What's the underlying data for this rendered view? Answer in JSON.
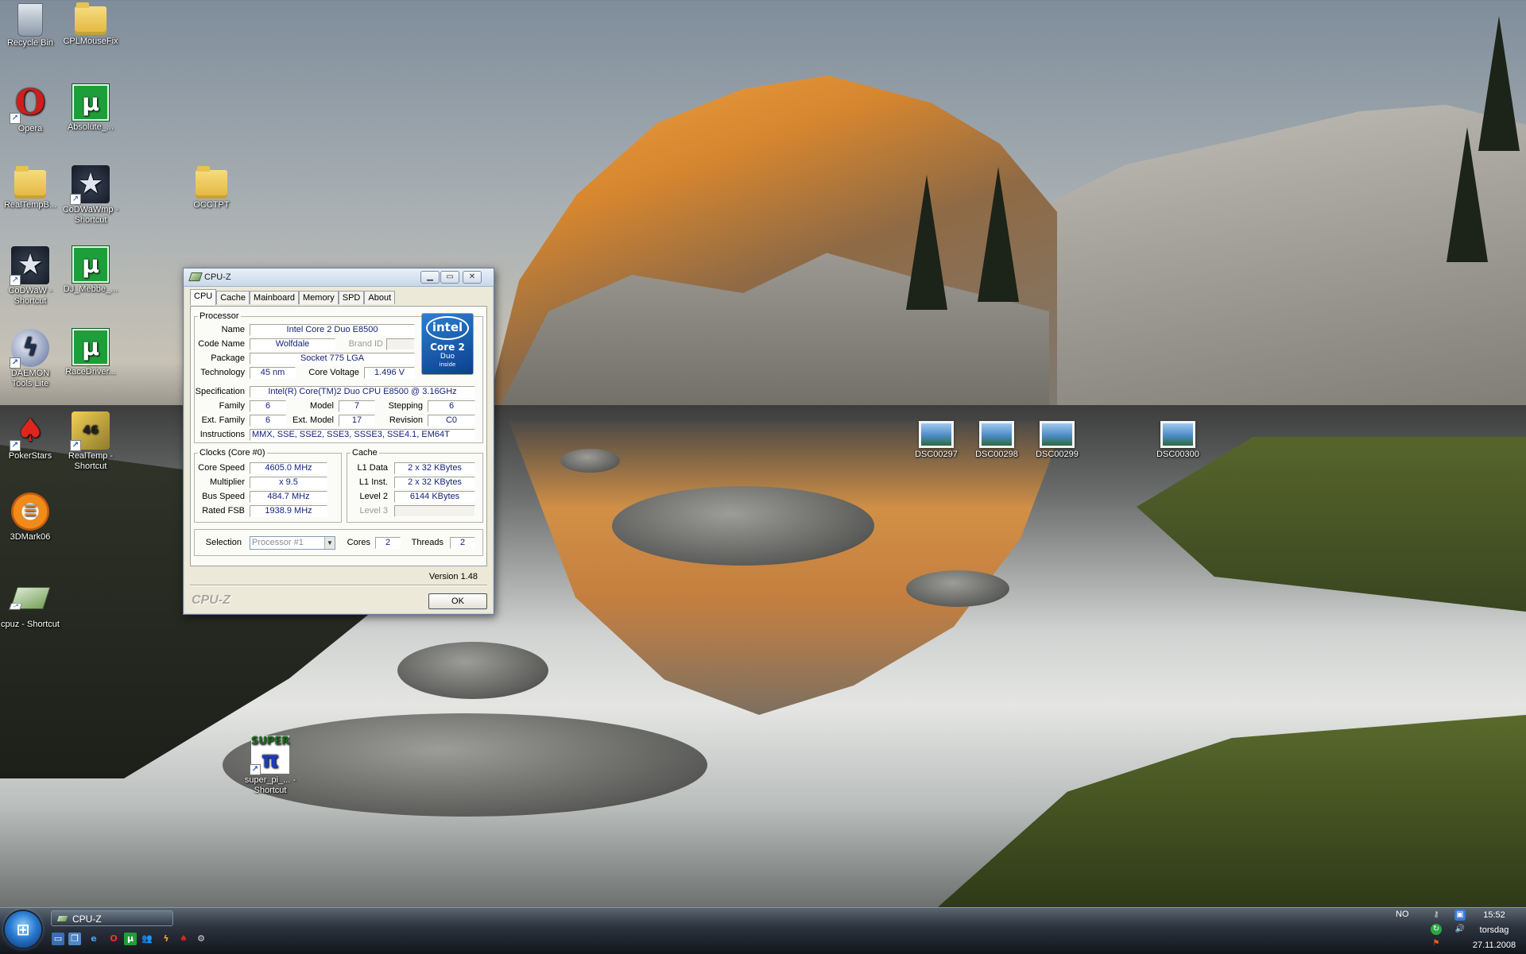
{
  "desktop_icons": [
    {
      "label": "Recycle Bin",
      "icon": "recycle-bin-icon"
    },
    {
      "label": "CPLMouseFix",
      "icon": "folder-icon"
    },
    {
      "label": "Opera",
      "icon": "opera-icon"
    },
    {
      "label": "Absolute_...",
      "icon": "utorrent-icon"
    },
    {
      "label": "RealTempB...",
      "icon": "folder-icon"
    },
    {
      "label": "CoDWaWmp - Shortcut",
      "icon": "codwaw-icon"
    },
    {
      "label": "OCCTPT",
      "icon": "folder-icon"
    },
    {
      "label": "CoDWaW - Shortcut",
      "icon": "codwaw-icon"
    },
    {
      "label": "DJ_Mebbe_...",
      "icon": "utorrent-icon"
    },
    {
      "label": "DAEMON Tools Lite",
      "icon": "daemon-tools-icon"
    },
    {
      "label": "RaceDriver...",
      "icon": "utorrent-icon"
    },
    {
      "label": "PokerStars",
      "icon": "pokerstars-icon"
    },
    {
      "label": "RealTemp - Shortcut",
      "icon": "realtemp-icon"
    },
    {
      "label": "3DMark06",
      "icon": "3dmark-icon"
    },
    {
      "label": "cpuz - Shortcut",
      "icon": "cpuz-icon"
    },
    {
      "label": "super_pi_... - Shortcut",
      "icon": "superpi-icon"
    },
    {
      "label": "DSC00297",
      "icon": "photo-icon"
    },
    {
      "label": "DSC00298",
      "icon": "photo-icon"
    },
    {
      "label": "DSC00299",
      "icon": "photo-icon"
    },
    {
      "label": "DSC00300",
      "icon": "photo-icon"
    }
  ],
  "cpuz": {
    "title": "CPU-Z",
    "tabs": [
      "CPU",
      "Cache",
      "Mainboard",
      "Memory",
      "SPD",
      "About"
    ],
    "active_tab": "CPU",
    "processor": {
      "legend": "Processor",
      "name_label": "Name",
      "name": "Intel Core 2 Duo E8500",
      "codename_label": "Code Name",
      "codename": "Wolfdale",
      "brandid_label": "Brand ID",
      "brandid": "",
      "package_label": "Package",
      "package": "Socket 775 LGA",
      "technology_label": "Technology",
      "technology": "45 nm",
      "voltage_label": "Core Voltage",
      "voltage": "1.496 V",
      "spec_label": "Specification",
      "spec": "Intel(R) Core(TM)2 Duo CPU     E8500  @ 3.16GHz",
      "family_label": "Family",
      "family": "6",
      "model_label": "Model",
      "model": "7",
      "stepping_label": "Stepping",
      "stepping": "6",
      "extfamily_label": "Ext. Family",
      "extfamily": "6",
      "extmodel_label": "Ext. Model",
      "extmodel": "17",
      "revision_label": "Revision",
      "revision": "C0",
      "instr_label": "Instructions",
      "instructions": "MMX, SSE, SSE2, SSE3, SSSE3, SSE4.1, EM64T",
      "logo": {
        "brand": "intel",
        "line1": "Core 2",
        "line2": "Duo",
        "line3": "inside"
      }
    },
    "clocks": {
      "legend": "Clocks (Core #0)",
      "core_speed_label": "Core Speed",
      "core_speed": "4605.0 MHz",
      "multiplier_label": "Multiplier",
      "multiplier": "x 9.5",
      "bus_speed_label": "Bus Speed",
      "bus_speed": "484.7 MHz",
      "rated_fsb_label": "Rated FSB",
      "rated_fsb": "1938.9 MHz"
    },
    "cache": {
      "legend": "Cache",
      "l1d_label": "L1 Data",
      "l1d": "2 x 32 KBytes",
      "l1i_label": "L1 Inst.",
      "l1i": "2 x 32 KBytes",
      "l2_label": "Level 2",
      "l2": "6144 KBytes",
      "l3_label": "Level 3",
      "l3": ""
    },
    "selection_label": "Selection",
    "selection": "Processor #1",
    "cores_label": "Cores",
    "cores": "2",
    "threads_label": "Threads",
    "threads": "2",
    "version": "Version 1.48",
    "brand": "CPU-Z",
    "ok_label": "OK"
  },
  "taskbar": {
    "start_icon": "windows-orb-icon",
    "task_label": "CPU-Z",
    "quick_launch": [
      "show-desktop-icon",
      "switch-windows-icon",
      "ie-icon",
      "opera-icon",
      "utorrent-icon",
      "messenger-icon",
      "winamp-icon",
      "pokerstars-icon",
      "steam-icon"
    ],
    "language": "NO",
    "time": "15:52",
    "day": "torsdag",
    "date": "27.11.2008"
  }
}
